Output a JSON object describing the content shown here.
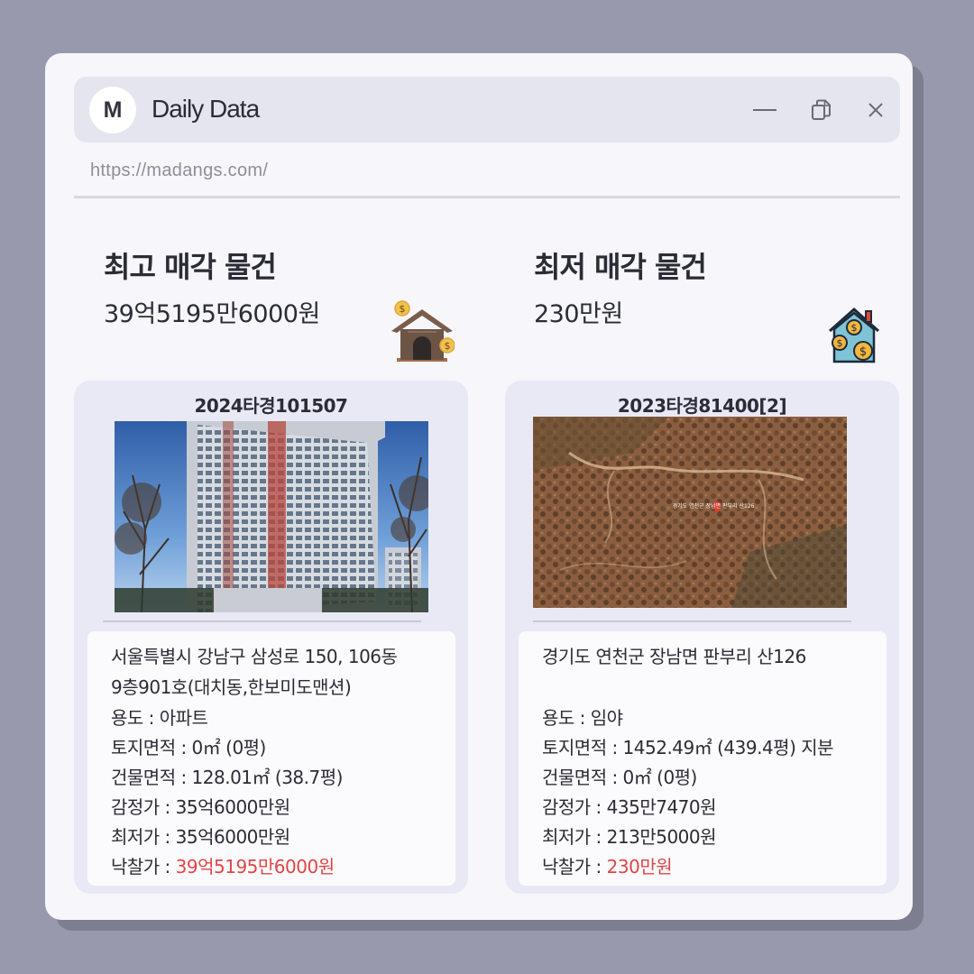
{
  "window": {
    "logo_letter": "M",
    "title": "Daily Data",
    "url": "https://madangs.com/"
  },
  "highest": {
    "heading": "최고 매각 물건",
    "price": "39억5195만6000원",
    "icon": "house-with-coins-icon",
    "case_no": "2024타경101507",
    "photo": "apartment-building-photo",
    "address_line1": "서울특별시 강남구 삼성로 150, 106동",
    "address_line2": "9층901호(대치동,한보미도맨션)",
    "usage": "용도 : 아파트",
    "land_area": "토지면적 : 0㎡ (0평)",
    "building_area": "건물면적 : 128.01㎡ (38.7평)",
    "appraisal": "감정가 : 35억6000만원",
    "min_price": "최저가 : 35억6000만원",
    "winning_label": "낙찰가 : ",
    "winning_value": "39억5195만6000원"
  },
  "lowest": {
    "heading": "최저 매각 물건",
    "price": "230만원",
    "icon": "house-with-coins-icon",
    "case_no": "2023타경81400[2]",
    "photo": "aerial-forest-map-photo",
    "map_label": "경기도 연천군 장남면 판부리 산126",
    "address_line1": "경기도 연천군 장남면 판부리 산126",
    "address_line2": "",
    "usage": "용도 : 임야",
    "land_area": "토지면적 : 1452.49㎡ (439.4평) 지분",
    "building_area": "건물면적 : 0㎡ (0평)",
    "appraisal": "감정가 : 435만7470원",
    "min_price": "최저가 : 213만5000원",
    "winning_label": "낙찰가 : ",
    "winning_value": "230만원"
  }
}
